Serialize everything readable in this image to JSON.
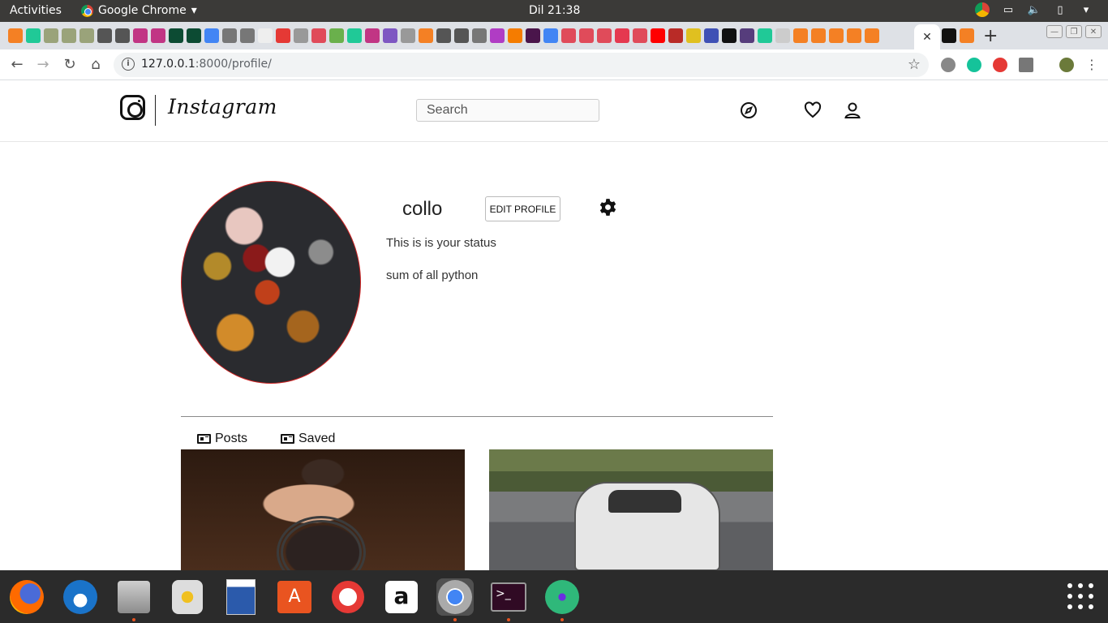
{
  "system_bar": {
    "activities": "Activities",
    "app_name": "Google Chrome",
    "clock": "Dil 21:38"
  },
  "browser": {
    "url_host": "127.0.0.1",
    "url_path": ":8000/profile/"
  },
  "instagram": {
    "wordmark": "Instagram",
    "search_placeholder": "Search",
    "profile": {
      "username": "collo",
      "edit_button": "EDIT PROFILE",
      "status": "This is is your status",
      "bio": "sum of all python"
    },
    "tabs": [
      {
        "label": "Posts"
      },
      {
        "label": "Saved"
      }
    ]
  },
  "colors": {
    "topbar": "#3b3a38",
    "tabstrip": "#dee1e6",
    "avatar_border": "#cc2222",
    "dock": "#2b2b2b",
    "ubuntu_accent": "#e95420"
  }
}
